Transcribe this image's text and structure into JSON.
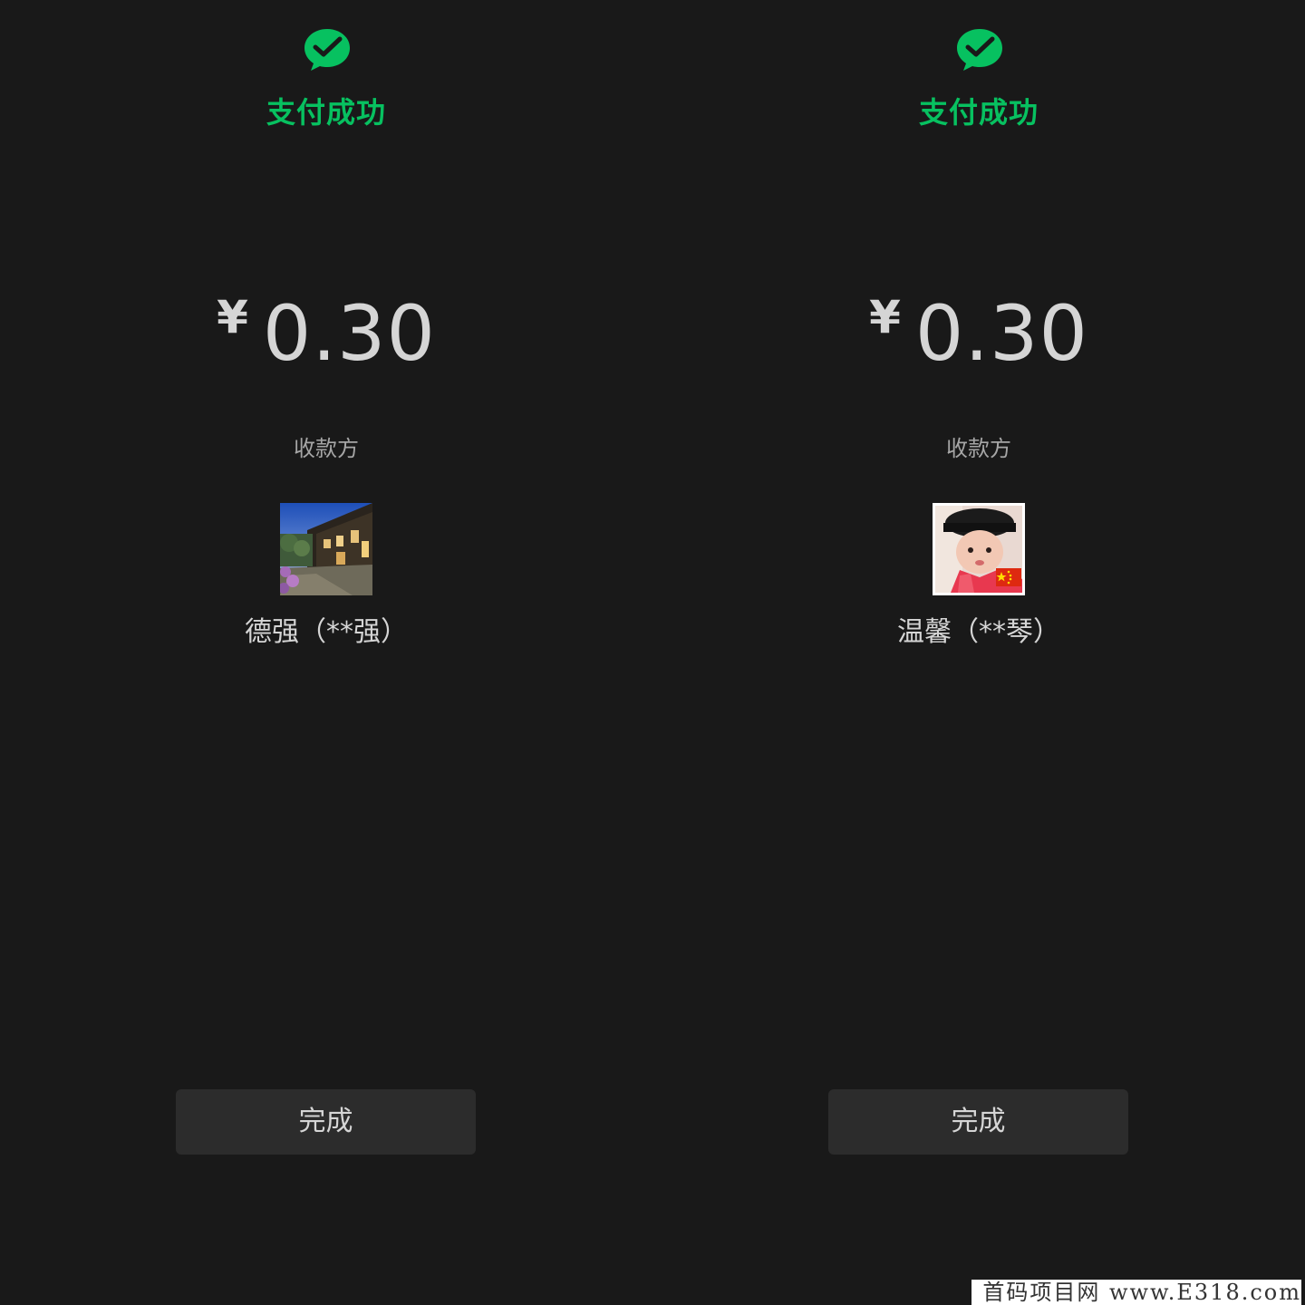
{
  "colors": {
    "background": "#191919",
    "accent_green": "#07c160",
    "text_primary": "#d5d5d5",
    "text_secondary": "#a6a6a6",
    "button_bg": "#2c2c2c"
  },
  "receipts": [
    {
      "icon": "wechat-pay-success-icon",
      "status_title": "支付成功",
      "currency_symbol": "¥",
      "amount": "0.30",
      "payee_label": "收款方",
      "avatar": "street-scene-avatar",
      "payee_name": "德强（**强）",
      "done_label": "完成"
    },
    {
      "icon": "wechat-pay-success-icon",
      "status_title": "支付成功",
      "currency_symbol": "¥",
      "amount": "0.30",
      "payee_label": "收款方",
      "avatar": "child-portrait-avatar",
      "payee_name": "温馨（**琴）",
      "done_label": "完成"
    }
  ],
  "watermark": "首码项目网 www.E318.com"
}
